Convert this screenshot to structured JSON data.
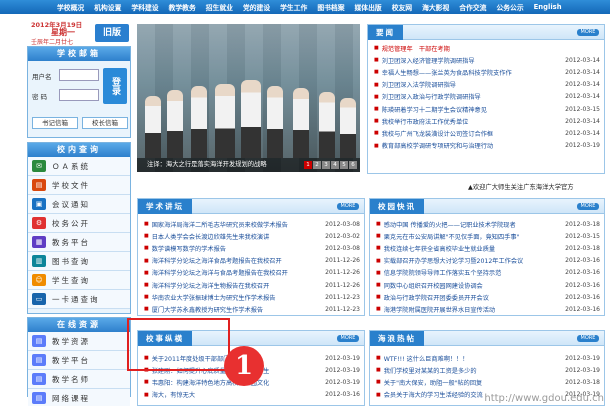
{
  "nav": [
    "学校概况",
    "机构设置",
    "学科建设",
    "教学教务",
    "招生就业",
    "党的建设",
    "学生工作",
    "图书档案",
    "媒体出版",
    "校友网",
    "海大影视",
    "合作交流",
    "公务公示",
    "English"
  ],
  "date": {
    "line1": "2012年3月19日",
    "weekday": "星期一",
    "lunar": "壬辰年二月廿七",
    "old_version": "旧版"
  },
  "mail": {
    "title": "学校邮箱",
    "user_label": "用户名",
    "pass_label": "密  码",
    "login": "登录",
    "btn1": "书记信箱",
    "btn2": "校长信箱"
  },
  "query": {
    "title": "校内查询",
    "items": [
      "ＯＡ系统",
      "学校文件",
      "会议通知",
      "校务公开",
      "教务平台",
      "图书查询",
      "学生查询",
      "一卡通查询"
    ]
  },
  "resources": {
    "title": "在线资源",
    "items": [
      "教学资源",
      "教学平台",
      "教学名师",
      "网络课程"
    ]
  },
  "banner": {
    "caption": "注译：海大之行是落实海洋开发规划的战略",
    "pages": [
      "1",
      "2",
      "3",
      "4",
      "5",
      "6"
    ]
  },
  "more_label": "MORE",
  "news": {
    "title": "要闻",
    "items": [
      {
        "text": "规范管理年　干部在考期",
        "date": ""
      },
      {
        "text": "刘卫团深入经济管理学院调研指导",
        "date": "2012-03-14"
      },
      {
        "text": "幸福人生畅想——张兰英为食品科技学院支作作",
        "date": "2012-03-14"
      },
      {
        "text": "刘卫团深入法学院调研指导",
        "date": "2012-03-14"
      },
      {
        "text": "刘卫团深入政治与行政学院调研指导",
        "date": "2012-03-14"
      },
      {
        "text": "陈瑛研着学习十二期学生会议精神意见",
        "date": "2012-03-15"
      },
      {
        "text": "我校举行市政府法工作优秀单位",
        "date": "2012-03-14"
      },
      {
        "text": "我校与广州飞龙装潢设计公司签订合作框",
        "date": "2012-03-14"
      },
      {
        "text": "教育部高校学调研专项研究和与治理行动",
        "date": "2012-03-19"
      }
    ]
  },
  "ticker": "▲欢迎广大师生关注广东海洋大学官方",
  "lectures": {
    "title": "学术讲坛",
    "items": [
      {
        "text": "国家海洋局海洋二所毛志华研究员来校做学术报告",
        "date": "2012-03-08"
      },
      {
        "text": "日本人类学会会长渡边欣雄先生来我校演讲",
        "date": "2012-03-02"
      },
      {
        "text": "数学谱模写数学的学术报告",
        "date": "2012-03-08"
      },
      {
        "text": "海洋科学分论坛之海洋食品考题报告在我校召开",
        "date": "2011-12-26"
      },
      {
        "text": "海洋科学分论坛之海洋与食品考题报告在我校召开",
        "date": "2011-12-26"
      },
      {
        "text": "海洋科学分论坛之海洋生物报告在我校召开",
        "date": "2011-12-26"
      },
      {
        "text": "华南农业大学张振球博士为研究生作学术报告",
        "date": "2011-12-23"
      },
      {
        "text": "厦门大学苏永鑫教授为研究生作学术报告",
        "date": "2011-12-23"
      }
    ]
  },
  "campus": {
    "title": "校园快讯",
    "items": [
      {
        "text": "感动中国 传播爱的火把——记职业技术学院现者",
        "date": "2012-03-18"
      },
      {
        "text": "栗克元在市公安局讲解\"不见仅手面，竟知四手事\"",
        "date": "2012-03-15"
      },
      {
        "text": "我校连续七年获全省高校毕业生就业质量",
        "date": "2012-03-18"
      },
      {
        "text": "实载部召开办学思想大讨论学习暨2012年工作会议",
        "date": "2012-03-16"
      },
      {
        "text": "信息学院院领导导师工作落实五个坚持示范",
        "date": "2012-03-16"
      },
      {
        "text": "同数中心组织召开校园网建设协调会",
        "date": "2012-03-16"
      },
      {
        "text": "政治与行政学院召开团委委员开开会议",
        "date": "2012-03-16"
      },
      {
        "text": "海港学院附属医院开展世界水日宣传活动",
        "date": "2012-03-16"
      }
    ]
  },
  "affairs": {
    "title": "校事纵横",
    "items": [
      {
        "text": "关于2011年度处级干部部门工作总结",
        "date": "2012-03-19"
      },
      {
        "text": "张建刚：如何提升心底质量我的教育和学生",
        "date": "2012-03-19"
      },
      {
        "text": "韦惠阳：构建海洋特色地方高校的校园文化",
        "date": "2012-03-19"
      },
      {
        "text": "海大，有惊无大",
        "date": "2012-03-16"
      }
    ]
  },
  "waves": {
    "title": "海浪热帖",
    "items": [
      {
        "text": "WTF!!! 这什么巨商难啊！！！",
        "date": "2012-03-19"
      },
      {
        "text": "我们学校里对某某的工资是多少的",
        "date": "2012-03-19"
      },
      {
        "text": "关于\"南大保安，助阻一般\"帖的回复",
        "date": "2012-03-18"
      },
      {
        "text": "会员关于海大的学习生活经验的交流",
        "date": "2012-03-19"
      }
    ]
  },
  "callout": "1",
  "watermark": "http://www.gdou.edu.cn"
}
